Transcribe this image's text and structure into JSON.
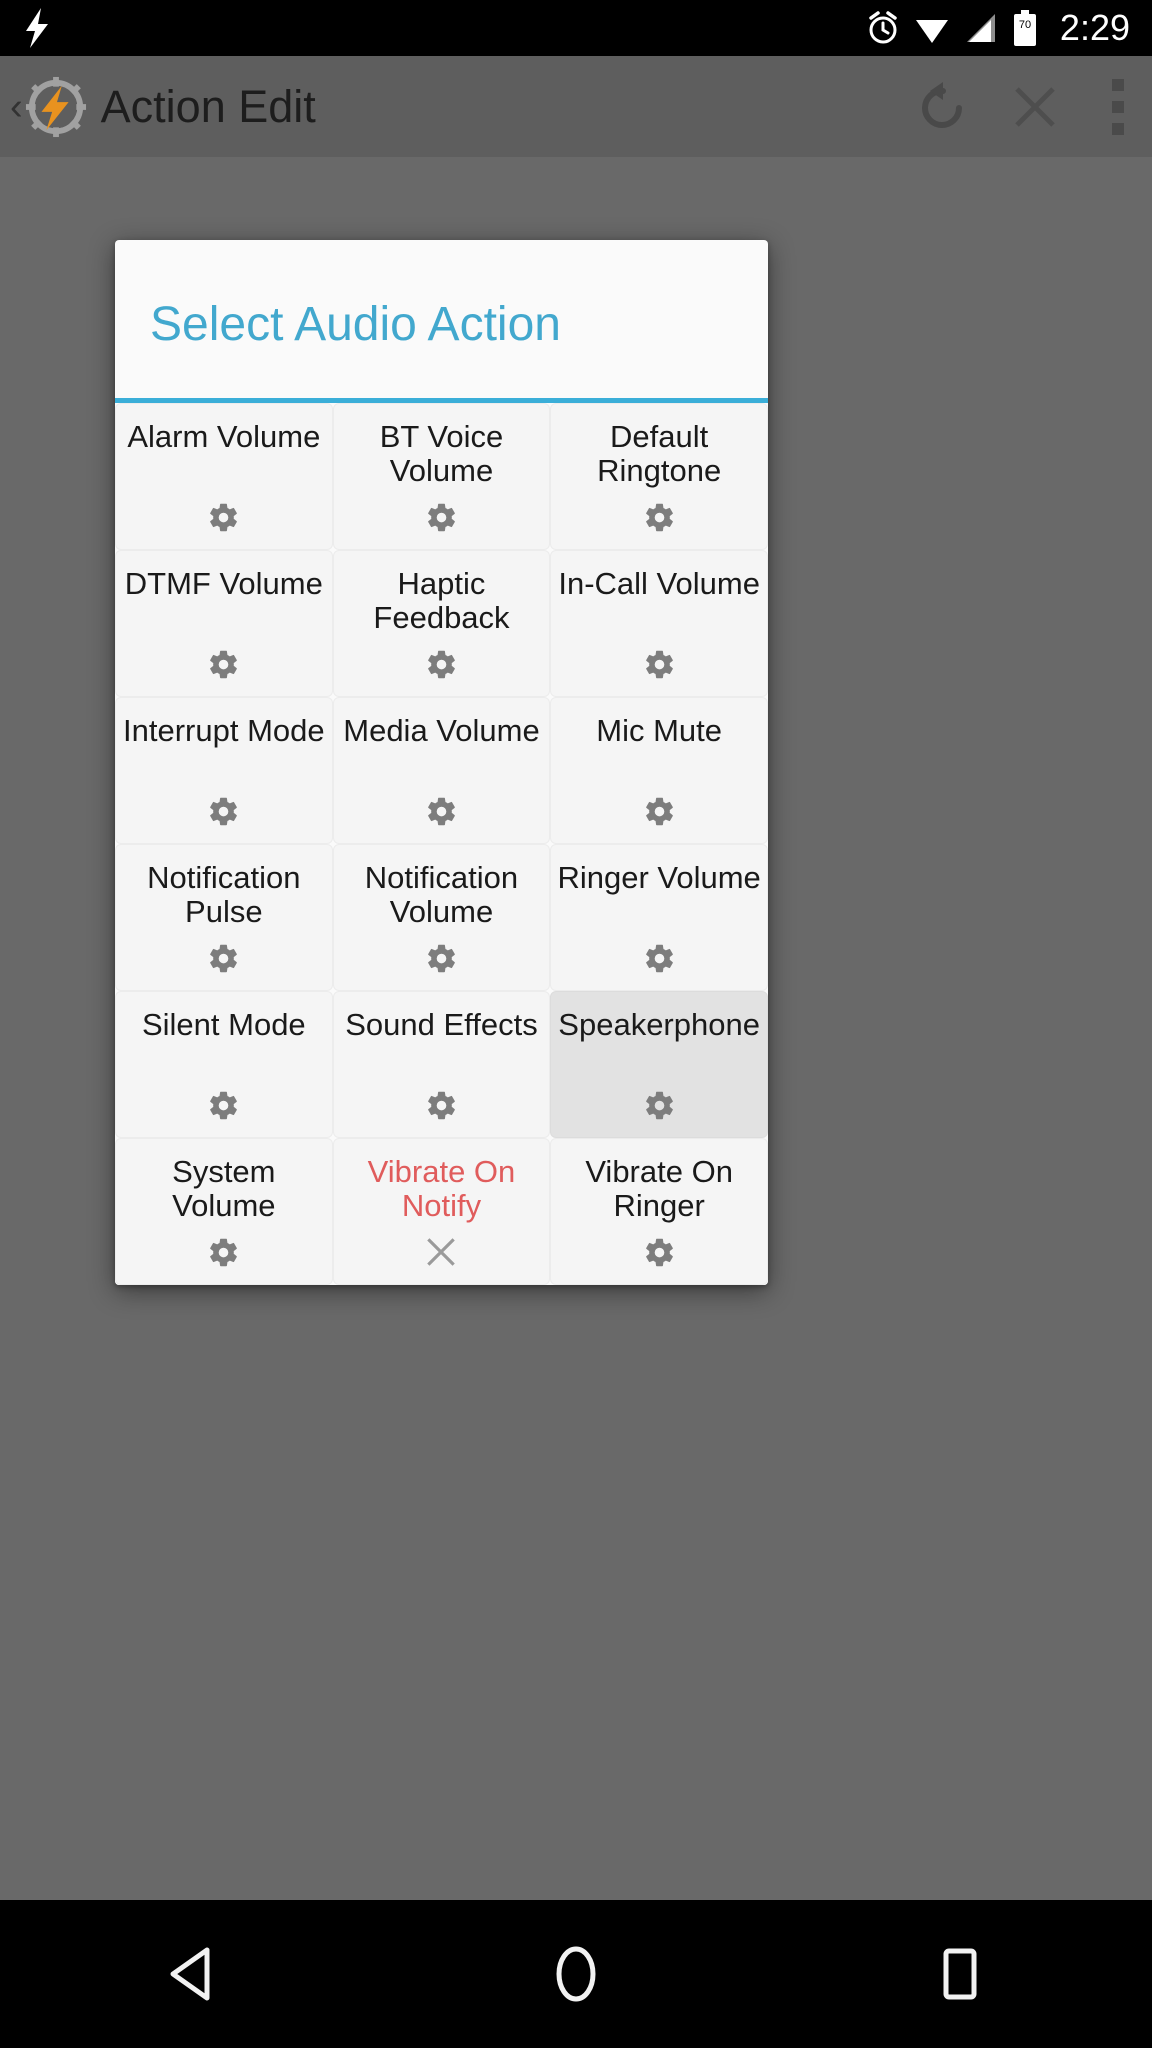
{
  "status_bar": {
    "time": "2:29",
    "battery_level": "70",
    "icons": [
      "tasker-bolt-icon",
      "alarm-icon",
      "wifi-icon",
      "signal-icon",
      "battery-icon"
    ]
  },
  "action_bar": {
    "title": "Action Edit",
    "back_glyph": "‹",
    "icons": [
      "tasker-logo-icon",
      "undo-icon",
      "close-icon",
      "overflow-menu-icon"
    ]
  },
  "dialog": {
    "title": "Select Audio Action",
    "accent_color": "#3aaed8",
    "title_color": "#42a8ce",
    "cell_bg": "#f5f5f5",
    "selected_bg": "#e2e2e2",
    "disabled_color": "#e05c5c",
    "items": [
      {
        "label": "Alarm Volume",
        "icon": "gear-icon",
        "state": "normal"
      },
      {
        "label": "BT Voice Volume",
        "icon": "gear-icon",
        "state": "normal"
      },
      {
        "label": "Default Ringtone",
        "icon": "gear-icon",
        "state": "normal"
      },
      {
        "label": "DTMF Volume",
        "icon": "gear-icon",
        "state": "normal"
      },
      {
        "label": "Haptic Feedback",
        "icon": "gear-icon",
        "state": "normal"
      },
      {
        "label": "In-Call Volume",
        "icon": "gear-icon",
        "state": "normal"
      },
      {
        "label": "Interrupt Mode",
        "icon": "gear-icon",
        "state": "normal"
      },
      {
        "label": "Media Volume",
        "icon": "gear-icon",
        "state": "normal"
      },
      {
        "label": "Mic Mute",
        "icon": "gear-icon",
        "state": "normal"
      },
      {
        "label": "Notification Pulse",
        "icon": "gear-icon",
        "state": "normal"
      },
      {
        "label": "Notification Volume",
        "icon": "gear-icon",
        "state": "normal"
      },
      {
        "label": "Ringer Volume",
        "icon": "gear-icon",
        "state": "normal"
      },
      {
        "label": "Silent Mode",
        "icon": "gear-icon",
        "state": "normal"
      },
      {
        "label": "Sound Effects",
        "icon": "gear-icon",
        "state": "normal"
      },
      {
        "label": "Speakerphone",
        "icon": "gear-icon",
        "state": "selected"
      },
      {
        "label": "System Volume",
        "icon": "gear-icon",
        "state": "normal"
      },
      {
        "label": "Vibrate On Notify",
        "icon": "close-icon",
        "state": "unavailable"
      },
      {
        "label": "Vibrate On Ringer",
        "icon": "gear-icon",
        "state": "normal"
      }
    ]
  },
  "nav_bar": {
    "buttons": [
      {
        "name": "back-button",
        "icon": "back-triangle-icon"
      },
      {
        "name": "home-button",
        "icon": "home-circle-icon"
      },
      {
        "name": "recents-button",
        "icon": "recents-square-icon"
      }
    ]
  }
}
